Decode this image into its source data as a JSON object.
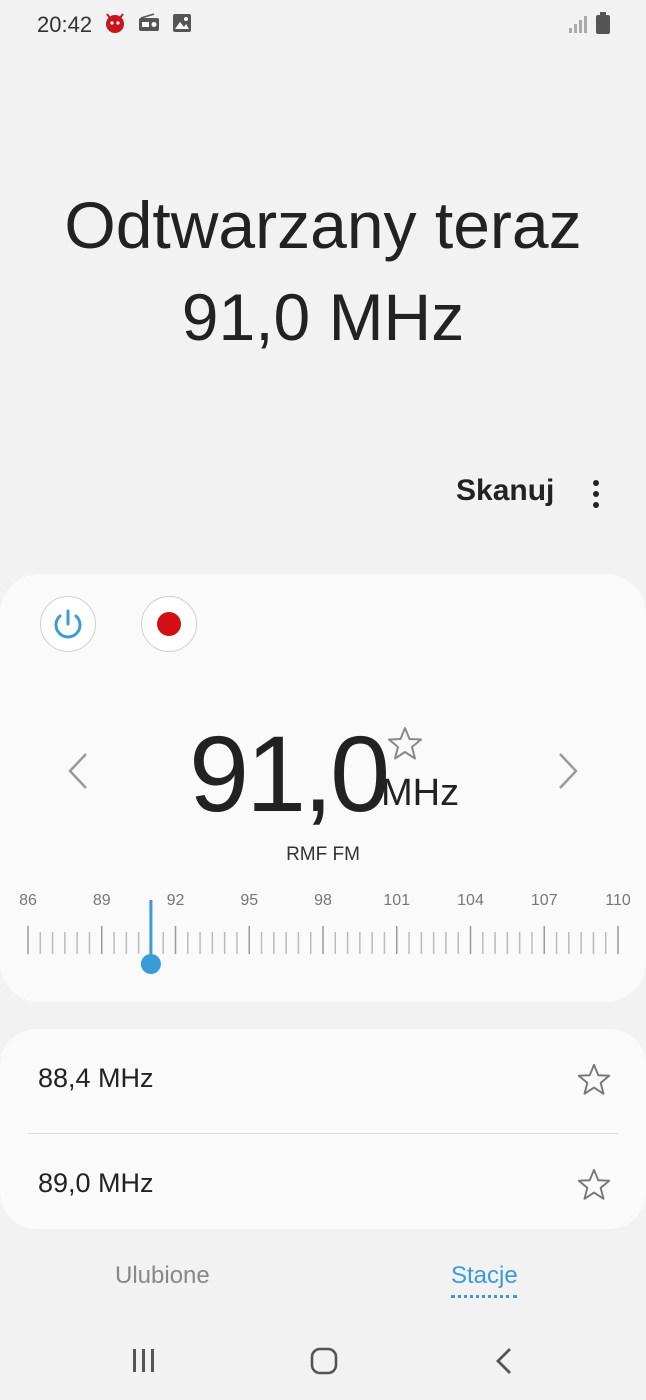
{
  "status_bar": {
    "time": "20:42",
    "left_icons": [
      "antutu-icon",
      "radio-icon",
      "image-icon"
    ],
    "right_icons": [
      "signal-icon",
      "battery-icon"
    ]
  },
  "header": {
    "now_playing_label": "Odtwarzany teraz",
    "now_playing_freq": "91,0 MHz"
  },
  "toolbar": {
    "scan_label": "Skanuj",
    "more_icon": "more-vertical-icon"
  },
  "tuner": {
    "frequency": "91,0",
    "unit": "MHz",
    "station_name": "RMF FM",
    "scale_labels": [
      "86",
      "89",
      "92",
      "95",
      "98",
      "101",
      "104",
      "107",
      "110"
    ],
    "scale_min": 86,
    "scale_max": 110,
    "current_value": 91.0,
    "accent_color": "#3b9bd8",
    "record_color": "#d30f16"
  },
  "stations": [
    {
      "label": "88,4 MHz"
    },
    {
      "label": "89,0 MHz"
    }
  ],
  "tabs": {
    "favorites": "Ulubione",
    "stations": "Stacje",
    "active": "stations"
  },
  "navbar": {
    "icons": [
      "recent-apps-icon",
      "home-icon",
      "back-icon"
    ]
  }
}
